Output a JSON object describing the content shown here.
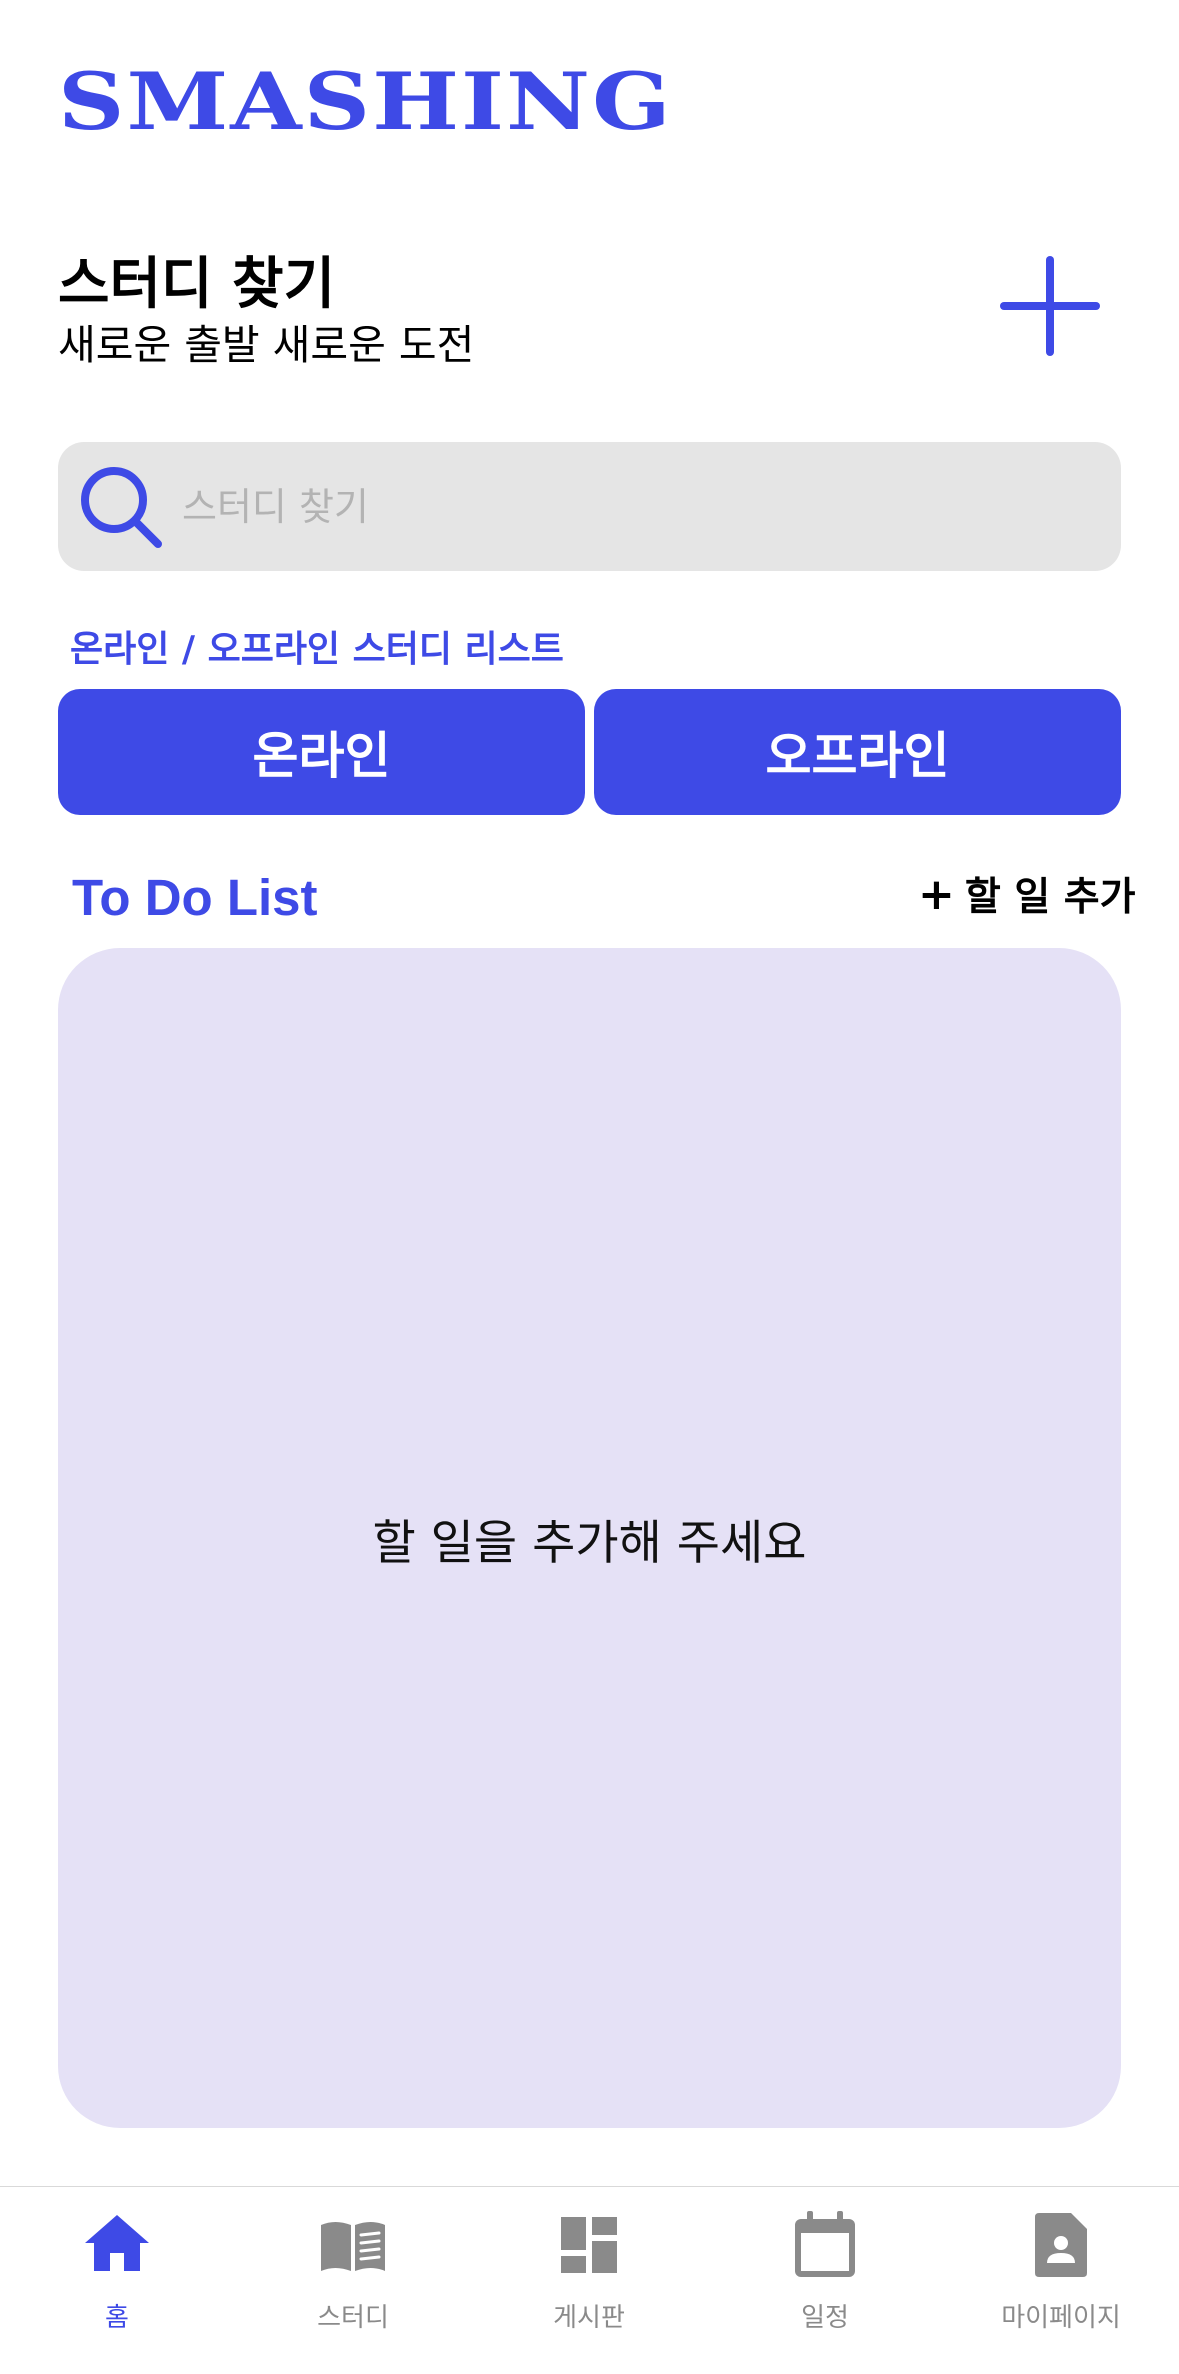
{
  "app": {
    "logo": "SMASHING"
  },
  "hero": {
    "title": "스터디 찾기",
    "subtitle": "새로운 출발 새로운 도전"
  },
  "search": {
    "placeholder": "스터디 찾기",
    "value": ""
  },
  "study_list": {
    "label": "온라인 / 오프라인 스터디 리스트",
    "online_label": "온라인",
    "offline_label": "오프라인"
  },
  "todo": {
    "title": "To Do List",
    "add_label": "할 일 추가",
    "empty_message": "할 일을 추가해 주세요"
  },
  "tabs": [
    {
      "label": "홈",
      "icon": "home-icon",
      "active": true
    },
    {
      "label": "스터디",
      "icon": "book-icon",
      "active": false
    },
    {
      "label": "게시판",
      "icon": "dashboard-icon",
      "active": false
    },
    {
      "label": "일정",
      "icon": "calendar-icon",
      "active": false
    },
    {
      "label": "마이페이지",
      "icon": "profile-document-icon",
      "active": false
    }
  ],
  "colors": {
    "accent": "#3e4ae6",
    "search_bg": "#e5e5e5",
    "todo_card_bg": "#e5e1f6",
    "tab_inactive": "#8a8a8a"
  }
}
